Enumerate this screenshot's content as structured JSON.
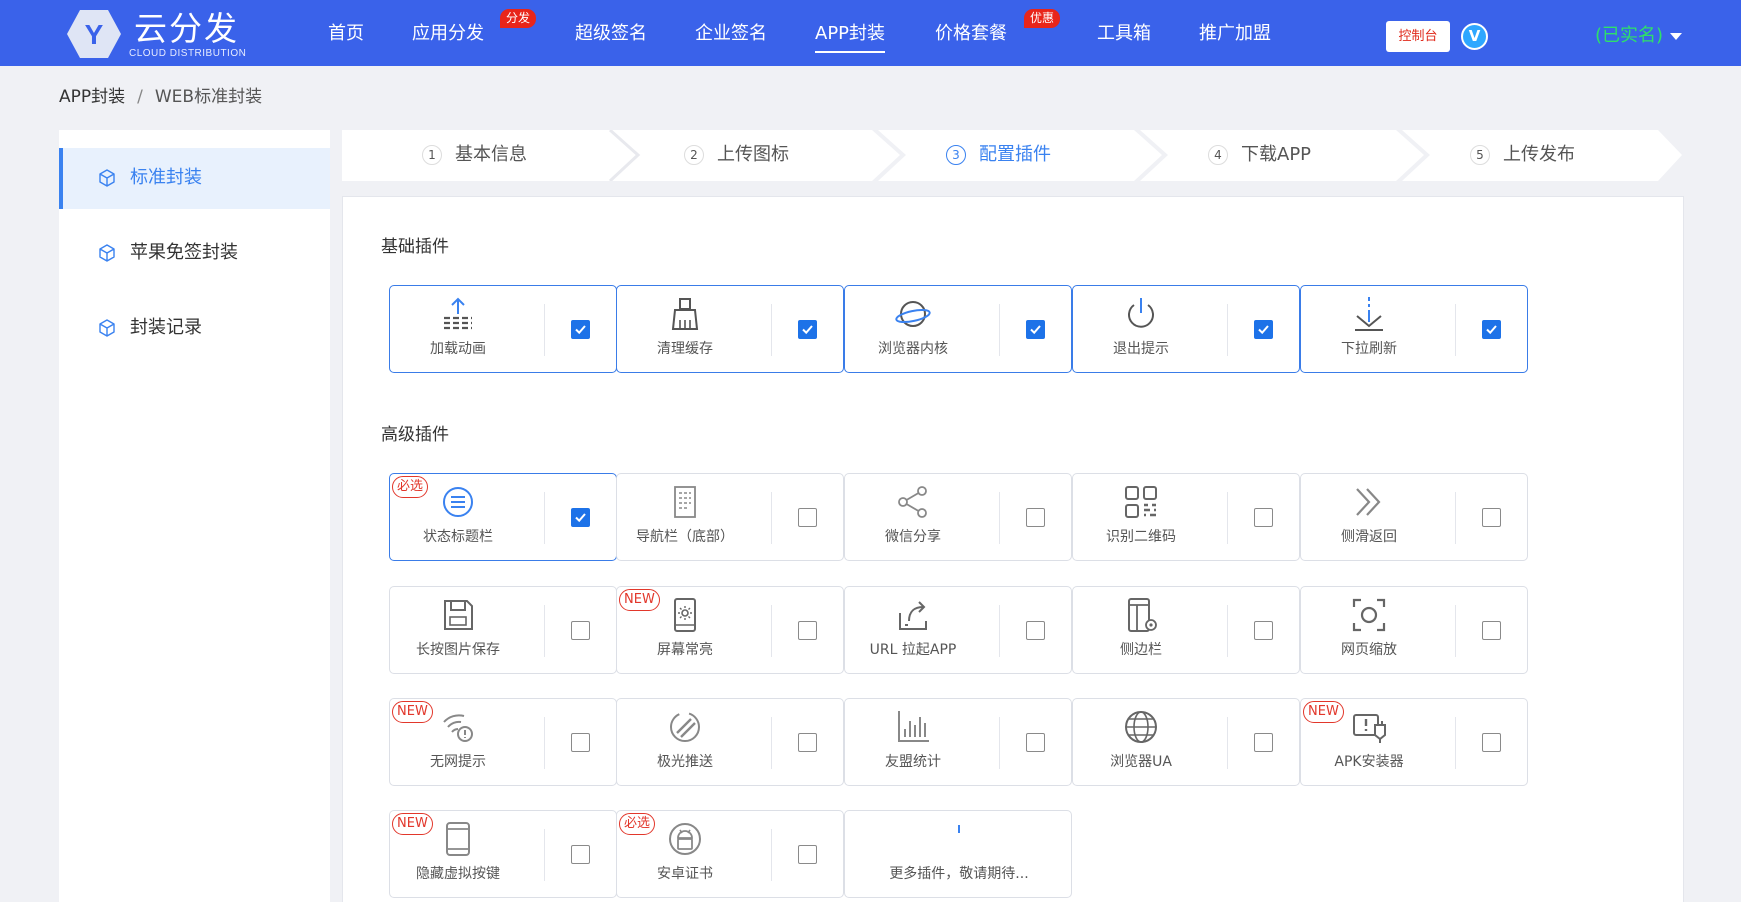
{
  "brand": {
    "name": "云分发",
    "sub": "CLOUD DISTRIBUTION",
    "logo_letter": "Y",
    "color": "#3a62ea"
  },
  "nav": {
    "items": [
      {
        "label": "首页"
      },
      {
        "label": "应用分发",
        "badge": "分发"
      },
      {
        "label": "超级签名"
      },
      {
        "label": "企业签名"
      },
      {
        "label": "APP封装",
        "active": true
      },
      {
        "label": "价格套餐",
        "badge": "优惠"
      },
      {
        "label": "工具箱"
      },
      {
        "label": "推广加盟"
      }
    ],
    "console": "控制台",
    "v_badge": "V",
    "user_status": "(已实名)"
  },
  "breadcrumb": {
    "parent": "APP封装",
    "separator": "/",
    "current": "WEB标准封装"
  },
  "sidebar": {
    "items": [
      {
        "label": "标准封装",
        "icon": "cube-icon",
        "active": true
      },
      {
        "label": "苹果免签封装",
        "icon": "cube-icon"
      },
      {
        "label": "封装记录",
        "icon": "cube-icon"
      }
    ]
  },
  "steps": [
    {
      "num": "1",
      "label": "基本信息"
    },
    {
      "num": "2",
      "label": "上传图标"
    },
    {
      "num": "3",
      "label": "配置插件",
      "active": true
    },
    {
      "num": "4",
      "label": "下载APP"
    },
    {
      "num": "5",
      "label": "上传发布"
    }
  ],
  "sections": {
    "basic": {
      "title": "基础插件",
      "plugins": [
        {
          "label": "加载动画",
          "icon": "upload-icon",
          "checked": true
        },
        {
          "label": "清理缓存",
          "icon": "broom-icon",
          "checked": true
        },
        {
          "label": "浏览器内核",
          "icon": "planet-icon",
          "checked": true
        },
        {
          "label": "退出提示",
          "icon": "power-icon",
          "checked": true
        },
        {
          "label": "下拉刷新",
          "icon": "pull-down-icon",
          "checked": true
        }
      ]
    },
    "advanced": {
      "title": "高级插件",
      "plugins": [
        {
          "label": "状态标题栏",
          "icon": "menu-circle-icon",
          "checked": true,
          "tag": "必选"
        },
        {
          "label": "导航栏（底部）",
          "icon": "document-icon",
          "checked": false
        },
        {
          "label": "微信分享",
          "icon": "share-icon",
          "checked": false
        },
        {
          "label": "识别二维码",
          "icon": "qrcode-icon",
          "checked": false
        },
        {
          "label": "侧滑返回",
          "icon": "double-chevron-icon",
          "checked": false
        },
        {
          "label": "长按图片保存",
          "icon": "save-icon",
          "checked": false
        },
        {
          "label": "屏幕常亮",
          "icon": "phone-brightness-icon",
          "checked": false,
          "tag": "NEW"
        },
        {
          "label": "URL 拉起APP",
          "icon": "launch-icon",
          "checked": false
        },
        {
          "label": "侧边栏",
          "icon": "sidebar-phone-icon",
          "checked": false
        },
        {
          "label": "网页缩放",
          "icon": "zoom-icon",
          "checked": false
        },
        {
          "label": "无网提示",
          "icon": "wifi-alert-icon",
          "checked": false,
          "tag": "NEW"
        },
        {
          "label": "极光推送",
          "icon": "jpush-icon",
          "checked": false
        },
        {
          "label": "友盟统计",
          "icon": "bar-chart-icon",
          "checked": false
        },
        {
          "label": "浏览器UA",
          "icon": "globe-icon",
          "checked": false
        },
        {
          "label": "APK安装器",
          "icon": "apk-installer-icon",
          "checked": false,
          "tag": "NEW"
        },
        {
          "label": "隐藏虚拟按键",
          "icon": "phone-icon",
          "checked": false,
          "tag": "NEW"
        },
        {
          "label": "安卓证书",
          "icon": "android-icon",
          "checked": false,
          "tag": "必选"
        },
        {
          "label": "更多插件，敬请期待...",
          "icon": "more-icon",
          "more": true
        }
      ]
    }
  },
  "colors": {
    "primary": "#3a82f0",
    "checkbox": "#1d72e8",
    "tag_red": "#e2372b",
    "verified": "#2ee06a"
  }
}
